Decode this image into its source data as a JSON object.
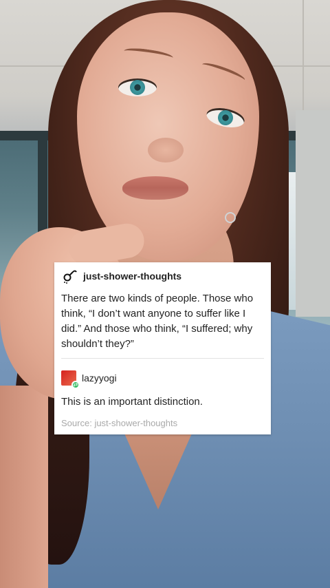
{
  "post": {
    "original_author": "just-shower-thoughts",
    "original_text": "There are two kinds of people. Those who think, “I don’t want anyone to suffer like I did.” And those who think, “I suffered; why shouldn’t they?”",
    "reblogger": "lazyyogi",
    "reblog_text": "This is an important distinction.",
    "source_label": "Source:",
    "source_name": "just-shower-thoughts"
  },
  "icons": {
    "author_avatar": "shower-head-icon",
    "reblogger_avatar": "user-avatar",
    "reblog_badge": "reblog-badge-icon"
  },
  "colors": {
    "card_bg": "#ffffff",
    "text": "#222222",
    "source_text": "#a9a9a9",
    "reblog_badge": "#3fbf6b",
    "avatar_red": "#d6211f"
  }
}
